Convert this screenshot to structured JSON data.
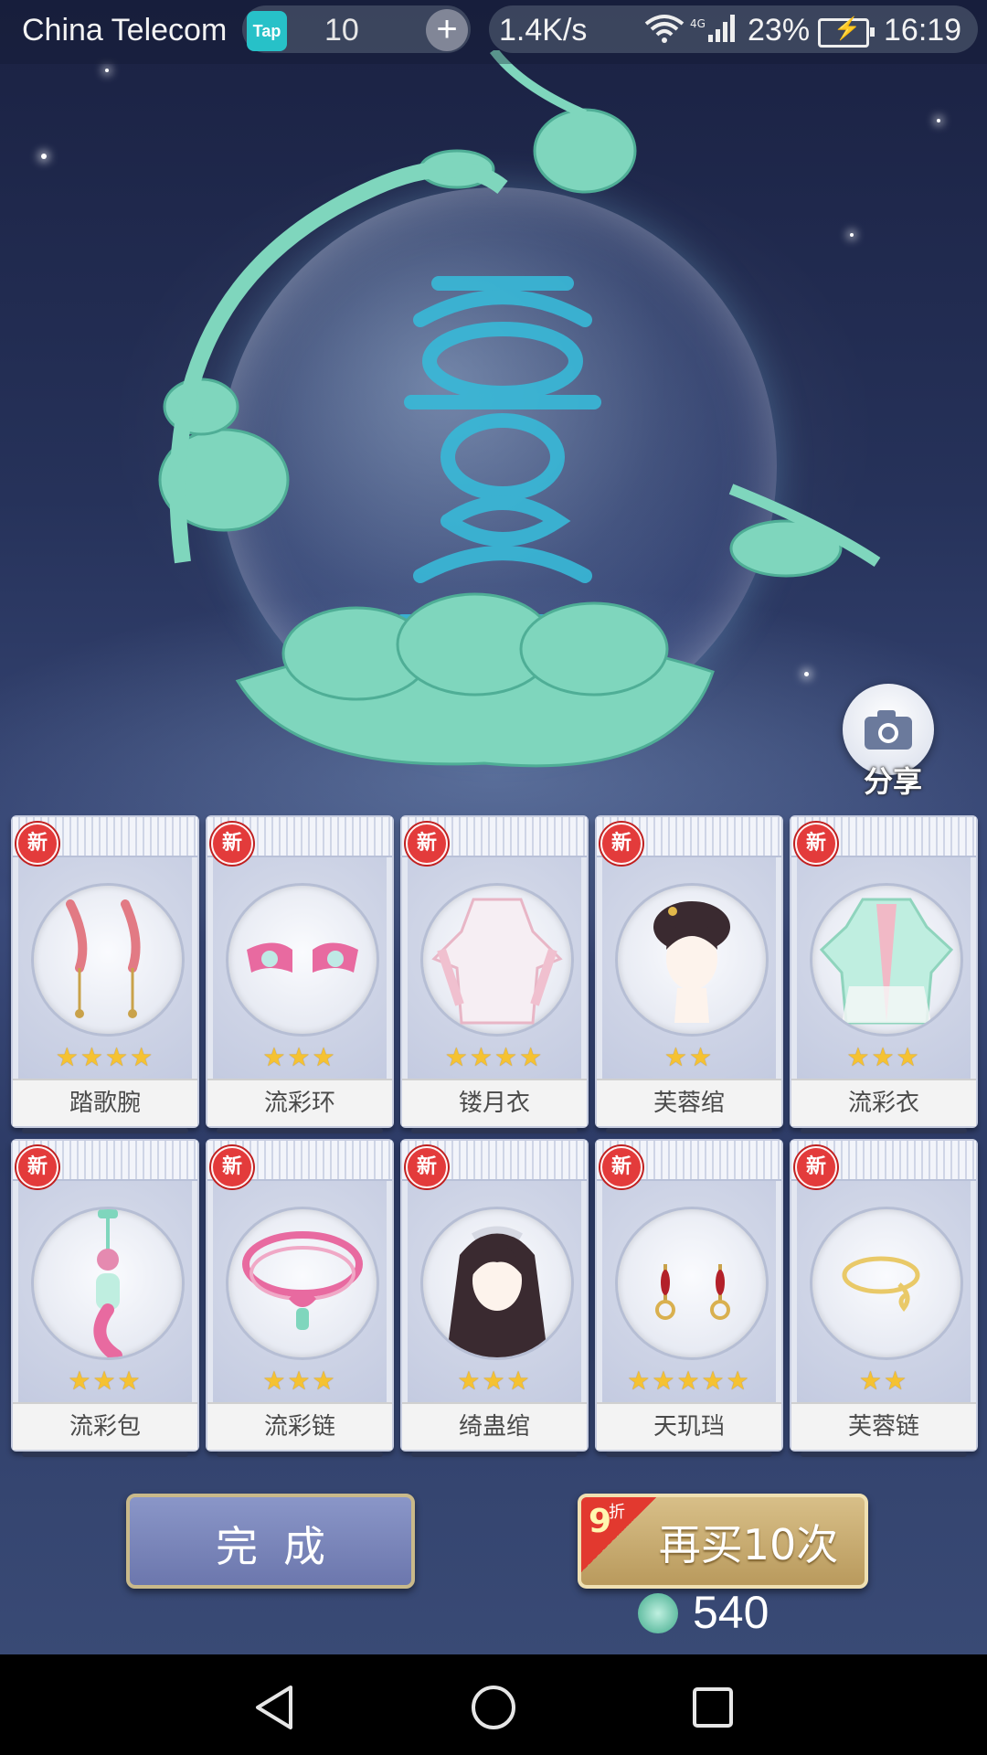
{
  "status_bar": {
    "carrier": "China Telecom",
    "tap_logo": "Tap",
    "tap_count": "10",
    "net_speed": "1.4K/s",
    "battery": "23%",
    "time": "16:19"
  },
  "share": {
    "label": "分享"
  },
  "cards": [
    {
      "name": "踏歌腕",
      "stars": "★★★★",
      "badge": "新"
    },
    {
      "name": "流彩环",
      "stars": "★★★",
      "badge": "新"
    },
    {
      "name": "镂月衣",
      "stars": "★★★★",
      "badge": "新"
    },
    {
      "name": "芙蓉绾",
      "stars": "★★",
      "badge": "新"
    },
    {
      "name": "流彩衣",
      "stars": "★★★",
      "badge": "新"
    },
    {
      "name": "流彩包",
      "stars": "★★★",
      "badge": "新"
    },
    {
      "name": "流彩链",
      "stars": "★★★",
      "badge": "新"
    },
    {
      "name": "绮蛊绾",
      "stars": "★★★",
      "badge": "新"
    },
    {
      "name": "天玑珰",
      "stars": "★★★★★",
      "badge": "新"
    },
    {
      "name": "芙蓉链",
      "stars": "★★",
      "badge": "新"
    }
  ],
  "buttons": {
    "done": "完成",
    "buy_again": "再买10次",
    "discount_num": "9",
    "discount_unit": "折"
  },
  "cost": {
    "value": "540"
  },
  "colors": {
    "star": "#f5c232",
    "new_badge": "#e33b3b",
    "jade": "#7fd6bd"
  }
}
